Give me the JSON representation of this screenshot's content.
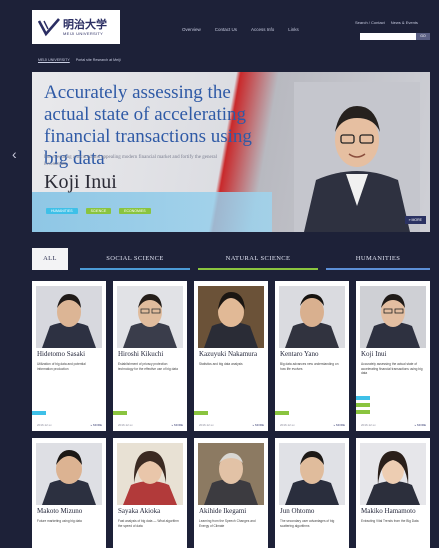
{
  "header": {
    "logo_jp": "明治大学",
    "logo_en": "MEIJI UNIVERSITY",
    "nav": [
      "Overview",
      "Contact Us",
      "Access Info",
      "Links"
    ],
    "toplinks": [
      "Search / Contact",
      "News & Events"
    ],
    "search_button": "GO"
  },
  "breadcrumb": [
    "MEIJI UNIVERSITY",
    "Portal site Research at Meiji"
  ],
  "hero": {
    "title": "Accurately assessing the actual state of accelerating financial transactions using big data",
    "subtitle": "For executing a secured and appealing modern financial market and fortify the general investment",
    "name": "Koji Inui",
    "tags": [
      "HUMANITIES",
      "SCIENCE",
      "ECONOMIES"
    ],
    "more": "» MORE",
    "prev": "‹"
  },
  "tabs": [
    {
      "label": "ALL",
      "active": true,
      "color": "#f3f3f5"
    },
    {
      "label": "SOCIAL SCIENCE",
      "active": false,
      "color": "#4c9bd6"
    },
    {
      "label": "NATURAL SCIENCE",
      "active": false,
      "color": "#8ac43f"
    },
    {
      "label": "HUMANITIES",
      "active": false,
      "color": "#5c8fd6"
    }
  ],
  "cards_row1": [
    {
      "name": "Hidetomo Sasaki",
      "desc": "Utilization of big data and potential information production",
      "chip": "#3ec0e8",
      "foot": "2016.12.xx",
      "more": "» MORE"
    },
    {
      "name": "Hiroshi Kikuchi",
      "desc": "Establishment of privacy protection technology for the effective use of big data",
      "chip": "#8ac43f",
      "foot": "2016.12.xx",
      "more": "» MORE"
    },
    {
      "name": "Kazuyuki Nakamura",
      "desc": "Statistics and big data analysis",
      "chip": "#8ac43f",
      "foot": "2016.12.xx",
      "more": "» MORE"
    },
    {
      "name": "Kentaro Yano",
      "desc": "Big data advances new understanding on how life evolves",
      "chip": "#8ac43f",
      "foot": "2016.12.xx",
      "more": "» MORE"
    },
    {
      "name": "Koji Inui",
      "desc": "Accurately assessing the actual state of accelerating financial transactions using big data",
      "chip": "#8ac43f",
      "foot": "2016.12.xx",
      "more": "» MORE"
    }
  ],
  "cards_row2": [
    {
      "name": "Makoto Mizuno",
      "desc": "Future marketing using big data"
    },
    {
      "name": "Sayaka Akioka",
      "desc": "Fast analysis of big data — What algorithm the speed of data"
    },
    {
      "name": "Akihide Ikegami",
      "desc": "Learning from the Speech Changes and Energy of Climate"
    },
    {
      "name": "Jun Ohtomo",
      "desc": "The secondary user advantages of big scattering algorithms"
    },
    {
      "name": "Makiko Hamamoto",
      "desc": "Extracting Vital Trends from the Big Data"
    }
  ]
}
